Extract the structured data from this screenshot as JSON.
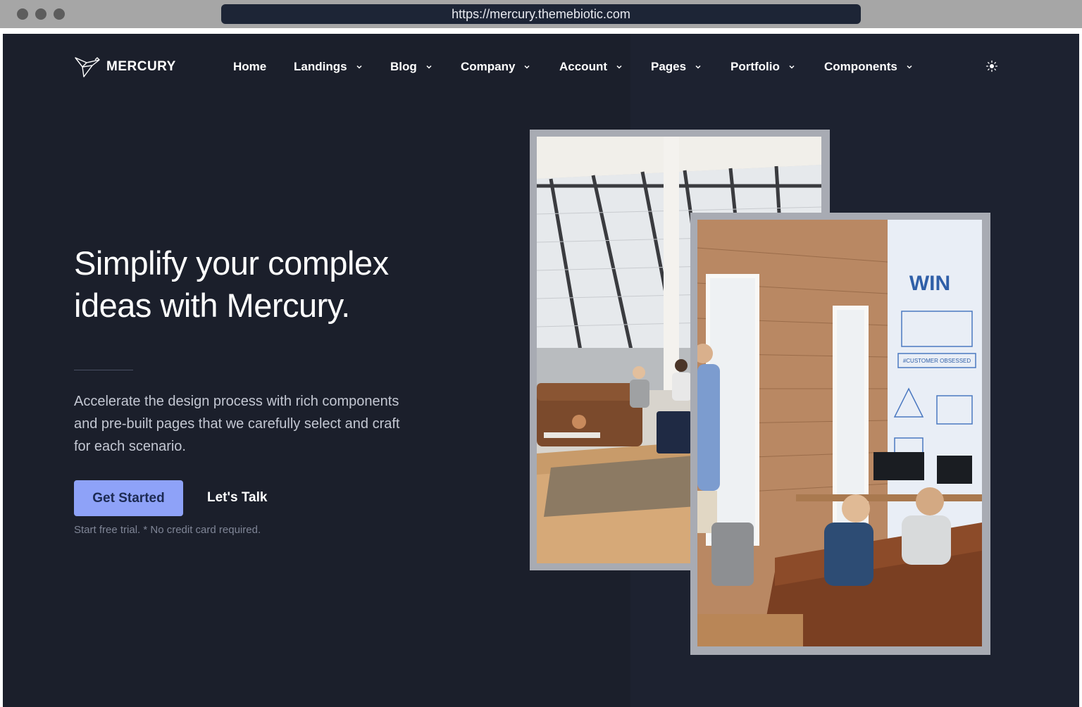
{
  "browser": {
    "url": "https://mercury.themebiotic.com"
  },
  "brand": {
    "name": "MERCURY",
    "logo_icon": "bird-logo-icon"
  },
  "nav": {
    "items": [
      {
        "label": "Home",
        "has_dropdown": false
      },
      {
        "label": "Landings",
        "has_dropdown": true
      },
      {
        "label": "Blog",
        "has_dropdown": true
      },
      {
        "label": "Company",
        "has_dropdown": true
      },
      {
        "label": "Account",
        "has_dropdown": true
      },
      {
        "label": "Pages",
        "has_dropdown": true
      },
      {
        "label": "Portfolio",
        "has_dropdown": true
      },
      {
        "label": "Components",
        "has_dropdown": true
      }
    ],
    "theme_toggle_icon": "sun-icon"
  },
  "hero": {
    "title": "Simplify your complex ideas with Mercury.",
    "description": "Accelerate the design process with rich components and pre-built pages that we carefully select and craft for each scenario.",
    "primary_button": "Get Started",
    "secondary_button": "Let's Talk",
    "hint": "Start free trial. * No credit card required."
  },
  "colors": {
    "background": "#1b1f2b",
    "primary_button": "#8ea2f8",
    "text": "#ffffff"
  }
}
